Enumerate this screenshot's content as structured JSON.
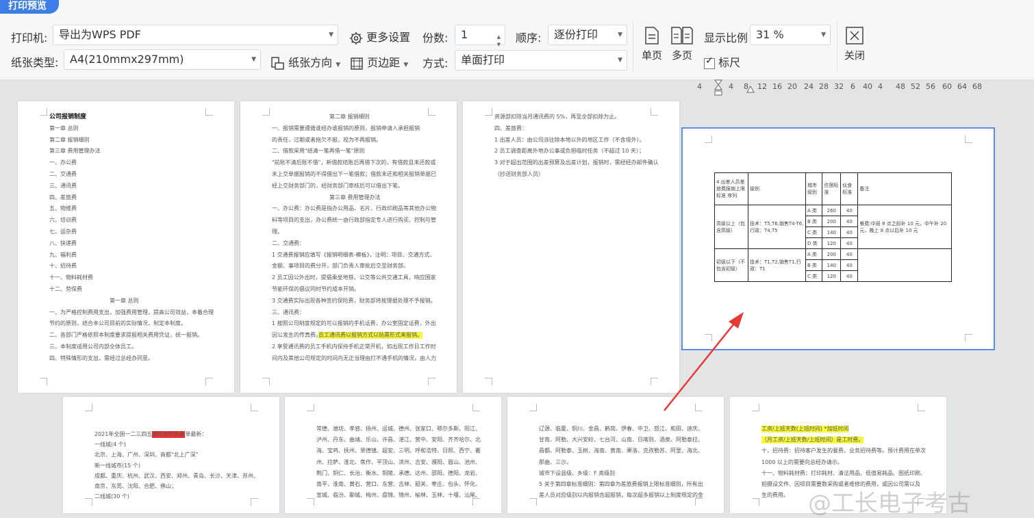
{
  "title": "打印预览",
  "printer": {
    "label": "打印机:",
    "value": "导出为WPS PDF"
  },
  "more_settings": "更多设置",
  "copies": {
    "label": "份数:",
    "value": "1"
  },
  "order": {
    "label": "顺序:",
    "value": "逐份打印"
  },
  "paper": {
    "label": "纸张类型:",
    "value": "A4(210mmx297mm)"
  },
  "orientation": "纸张方向",
  "margins": "页边距",
  "mode": {
    "label": "方式:",
    "value": "单面打印"
  },
  "single_page": "单页",
  "multi_page": "多页",
  "zoom": {
    "label": "显示比例",
    "value": "31 %"
  },
  "ruler_toggle": "标尺",
  "close": "关闭",
  "ruler_ticks": [
    "4",
    "4",
    "8",
    "12",
    "16",
    "20",
    "24",
    "28",
    "32",
    "6",
    "40",
    "4",
    "48",
    "52",
    "56",
    "60",
    "64",
    "68"
  ],
  "page1": {
    "lines": [
      "公司报销制度",
      "第一章 总则",
      "第二章 报销细则",
      "第三章 费用管理办法",
      "一、办公费",
      "二、交通费",
      "三、通讯费",
      "四、差旅费",
      "五、物维费",
      "六、培训费",
      "七、运杂费",
      "八、快递费",
      "九、福利费",
      "十、招待费",
      "十一、物料耗材费",
      "十二、劳保费",
      "第一章 总则",
      "一、为严格控制费用支出，加强费用管理，提高公司效益，本着合理",
      "节约的原则，结合本公司目前的实际情况，制定本制度。",
      "二、各部门严格依照本制度要求提报相关费用凭证，统一报销。",
      "三、本制度适用公司内部全体员工。",
      "四、特殊情形的支出，需经过总经办同意。"
    ]
  },
  "page2": {
    "lines": [
      "第二章 报销细则",
      "一、报销需要遵循谁经办谁报销的原则，报销申请人承担报销",
      "的责任，过期或者拖欠不报，视为不再报销。",
      "二、借款采用\"结清一笔再借一笔\"原则",
      "\"前账不清后账不借\"，新借款结账后再借下次的，有借款且未还款或",
      "未上交单据报销的不得借出下一笔借款；借款未还和相关报销单据已",
      "经上交财务部门的，经财务部门审核后可以借出下笔。",
      "第三章 费用管理办法",
      "一、办公费：办公费是指办公用品、名片、行政印刷品等其他办公物",
      "料等项目的支出，办公费统一由行政部指定专人进行购买、控制与管",
      "理。",
      "二、交通费：",
      "1 交通费报销应填写《报销明细表-模板》，注明：项目、交通方式、",
      "金额、事项目的费分开，部门负责人审批后交至财务部。",
      "2 员工因公外出时，提倡乘坐地铁、公交等公共交通工具，响应国家",
      "节能环保的倡议同时节约成本开销。",
      "3 交通费实际出现各种签约保险费，财务部将按理据处理不予报销。",
      "三、通讯费：",
      "1 按照公司制度规定的可以报销的手机话费，办公室固定话费，外出",
      "因公发生的传真费。",
      "2 享受通讯费的员工手机内保持手机正常开机，如出现工作日工作时",
      "间内及其他公司规定的时间内无正当理由打不通手机的情况，由人力"
    ],
    "highlight": "员工通讯费以报销方式以贴票形式来报销。"
  },
  "page3": {
    "lines": [
      "资源部扣除当月通讯费的 5%，再至全部扣除为止。",
      "四、差旅费：",
      "1 出差人员：由公司派往除本地以外的地区工作（不含境外）。",
      "2 员工调查距离外地办公事或负担临时任务（不超过 10 天）；",
      "3 对于超出范围的出差预算及出差计划，报销时，需经经办邮件确认",
      "（抄送财务部人员）"
    ]
  },
  "page4": {
    "headers": [
      "4 出差人员差旅费报销上限标准 序列",
      "级别",
      "城市级别",
      "住宿标准",
      "伙食标准",
      "备注"
    ],
    "groups": [
      {
        "level": "高级以上（包含高级）",
        "rank": "技术：T5,T6,销售T4-T6,行政：T4,T5",
        "rows": [
          [
            "A 类",
            "260",
            "40"
          ],
          [
            "B 类",
            "200",
            "40"
          ],
          [
            "C 类",
            "140",
            "40"
          ],
          [
            "D 类",
            "120",
            "40"
          ]
        ]
      },
      {
        "level": "初级以下（不包含初级）",
        "rank": "技术：T1,T2,销售T1,行政：T1",
        "rows": [
          [
            "A 类",
            "200",
            "40"
          ],
          [
            "B 类",
            "140",
            "40"
          ],
          [
            "C 类",
            "120",
            "40"
          ]
        ]
      }
    ],
    "note": "餐费:中层 8 点之前补 10 元，中午补 20 元，晚上 8 点以后补 10 元"
  },
  "page5": {
    "lines": [
      "2021年全国一二三四五线城市划分名单最新：",
      "一线城(4 个)",
      "北京、上海、广州、深圳、商都\"北上广深\"",
      "新一线城市(15 个)",
      "成都、重庆、杭州、武汉、西安、郑州、青岛、长沙、天津、苏州、",
      "南京、东莞、沈阳、合肥、佛山；",
      "二线城(30 个)"
    ],
    "red": "城市划分名单"
  },
  "page6": {
    "lines": [
      "常德、潍坊、孝感、扬州、运城、德州、张家口、鄂尔多斯、阳江、",
      "泸州、丹东、曲靖、乐山、许昌、湛江、营中、安阳、齐齐哈尔、北",
      "海、宝鸡、抚州、景德镇、超安、三明、呼和浩特、日照、西宁、衢",
      "州、拉萨、淮北、焦作、平顶山、滨州、吉安、濮阳、眉山、池州、",
      "荆门、铜仁、长治、衡水、铜陵、承德、达州、邵阳、德阳、龙岩、",
      "南平、淮南、黄石、营口、东营、吉林、韶关、枣庄、包头、怀化、",
      "宣城、临汾、聊城、梅州、盘锦、锦州、榆林、玉林、十堰、汕尾、"
    ]
  },
  "page7": {
    "lines": [
      "辽源、临夏、铜川、金昌、鹤岗、伊春、中卫、怒江、和田、迪庆、",
      "甘南、阿勒、大兴安岭、七台河、山南、日喀则、酒泉、阿勒泰拉、",
      "昌都、阿勒泰、玉树、海南、黄南、果洛、克孜勒苏、阿里、海北、",
      "那曲、三沙。",
      "城市下设县级、乡级：F 类级别",
      "5 关于第四章标准细则：第四章为差旅费报销上限标准细则，所有出",
      "差人员对应级别以内报销含超报销，每次超多报销以上制度规定的金"
    ]
  },
  "page8": {
    "lines": [
      "工资/上班天数(上班时间) *加班时间",
      "（月工资/上班天数/上班时间）是工时费。",
      "十、招待费：招待客户发生的餐费、业务招待费等。预计费用在单次",
      "1000 以上的需要向总经办请示。",
      "十一、物料耗材费：打印耗材、清洁用品、低值易耗品、图纸印刷、",
      "拍摄设文件、因项目需要数采购或者维修的费用，或因公司需以及",
      "生的费用。"
    ]
  },
  "watermark": "@工长电子考古"
}
